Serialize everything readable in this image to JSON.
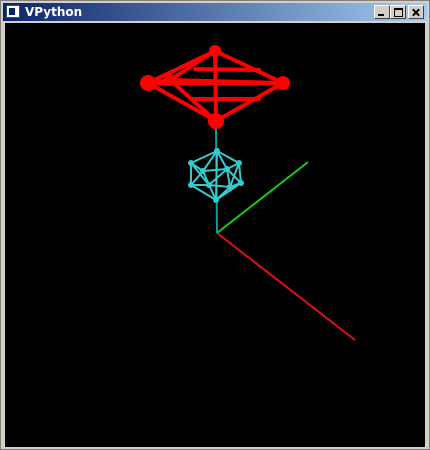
{
  "window": {
    "title": "VPython",
    "icon": "vpython-app-icon"
  },
  "controls": [
    "minimize-icon",
    "maximize-icon",
    "close-icon"
  ],
  "scene": {
    "background": "#000000",
    "colors": {
      "x_axis": "#e01010",
      "y_axis": "#10d010",
      "z_axis": "#00a0a0",
      "octahedron": "#ff0000",
      "icosahedron": "#33cccc"
    }
  }
}
